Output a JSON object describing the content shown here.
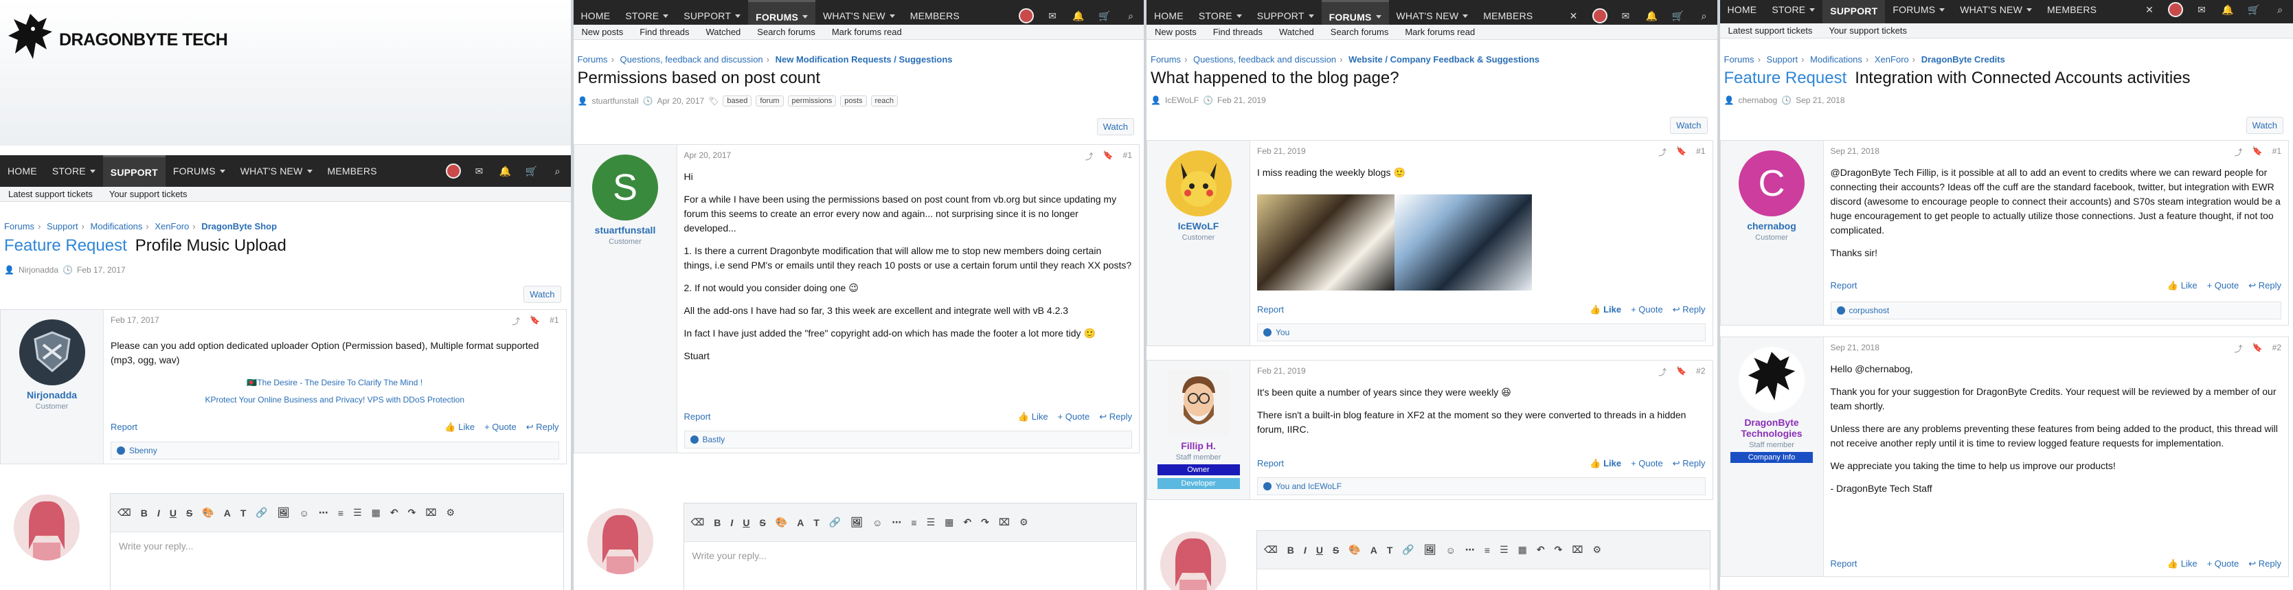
{
  "site": {
    "name": "DRAGONBYTE TECH"
  },
  "nav": {
    "home": "HOME",
    "store": "STORE",
    "support": "SUPPORT",
    "forums": "FORUMS",
    "whats_new": "WHAT'S NEW",
    "members": "MEMBERS"
  },
  "icons": [
    "mail-icon",
    "bell-icon",
    "cart-icon",
    "search-icon"
  ],
  "panel1": {
    "subnav": [
      "Latest support tickets",
      "Your support tickets"
    ],
    "crumbs": [
      "Forums",
      "Support",
      "Modifications",
      "XenForo",
      "DragonByte Shop"
    ],
    "prefix": "Feature Request",
    "title": "Profile Music Upload",
    "author": "Nirjonadda",
    "date": "Feb 17, 2017",
    "watch": "Watch",
    "post": {
      "user": "Nirjonadda",
      "usertitle": "Customer",
      "date": "Feb 17, 2017",
      "num": "#1",
      "text": "Please can you add option dedicated uploader Option (Permission based), Multiple format supported (mp3, ogg, wav)",
      "sig1": "The Desire - The Desire To Clarify The Mind !",
      "sig2": "Protect Your Online Business and Privacy! VPS with DDoS Protection",
      "report": "Report",
      "like": "Like",
      "quote": "+ Quote",
      "reply": "Reply",
      "reacted": "Sbenny"
    },
    "editor_placeholder": "Write your reply..."
  },
  "panel2": {
    "subnav": [
      "New posts",
      "Find threads",
      "Watched",
      "Search forums",
      "Mark forums read"
    ],
    "crumbs": [
      "Forums",
      "Questions, feedback and discussion",
      "New Modification Requests / Suggestions"
    ],
    "title": "Permissions based on post count",
    "author": "stuartfunstall",
    "date": "Apr 20, 2017",
    "tags": [
      "based",
      "forum",
      "permissions",
      "posts",
      "reach"
    ],
    "watch": "Watch",
    "post": {
      "user": "stuartfunstall",
      "usertitle": "Customer",
      "date": "Apr 20, 2017",
      "num": "#1",
      "p1": "Hi",
      "p2": "For a while I have been using the permissions based on post count from vb.org but since updating my forum this seems to create an error every now and again... not surprising since it is no longer developed...",
      "p3": "1. Is there a current Dragonbyte modification that will allow me to stop new members doing certain things, i.e send PM's or emails until they reach 10 posts or use a certain forum until they reach XX posts?",
      "p4": "2. If not would you consider doing one",
      "p5": "All the add-ons I have had so far, 3 this week are excellent and integrate well with vB 4.2.3",
      "p6": "In fact I have just added the \"free\" copyright add-on which has made the footer a lot more tidy",
      "p7": "Stuart",
      "report": "Report",
      "like": "Like",
      "quote": "+ Quote",
      "reply": "Reply",
      "reacted": "Bastly"
    },
    "editor_placeholder": "Write your reply..."
  },
  "panel3": {
    "subnav": [
      "New posts",
      "Find threads",
      "Watched",
      "Search forums",
      "Mark forums read"
    ],
    "crumbs": [
      "Forums",
      "Questions, feedback and discussion",
      "Website / Company Feedback & Suggestions"
    ],
    "title": "What happened to the blog page?",
    "author": "IcEWoLF",
    "date": "Feb 21, 2019",
    "watch": "Watch",
    "post1": {
      "user": "IcEWoLF",
      "usertitle": "Customer",
      "date": "Feb 21, 2019",
      "num": "#1",
      "text": "I miss reading the weekly blogs",
      "report": "Report",
      "like": "Like",
      "quote": "+ Quote",
      "reply": "Reply",
      "reacted": "You"
    },
    "post2": {
      "user": "Fillip H.",
      "usertitle": "Staff member",
      "banner1": "Owner",
      "banner2": "Developer",
      "date": "Feb 21, 2019",
      "num": "#2",
      "p1": "It's been quite a number of years since they were weekly",
      "p2": "There isn't a built-in blog feature in XF2 at the moment so they were converted to threads in a hidden forum, IIRC.",
      "report": "Report",
      "like": "Like",
      "quote": "+ Quote",
      "reply": "Reply",
      "reacted": "You and IcEWoLF"
    }
  },
  "panel4": {
    "subnav": [
      "Latest support tickets",
      "Your support tickets"
    ],
    "crumbs": [
      "Forums",
      "Support",
      "Modifications",
      "XenForo",
      "DragonByte Credits"
    ],
    "prefix": "Feature Request",
    "title": "Integration with Connected Accounts activities",
    "author": "chernabog",
    "date": "Sep 21, 2018",
    "watch": "Watch",
    "post1": {
      "user": "chernabog",
      "usertitle": "Customer",
      "date": "Sep 21, 2018",
      "num": "#1",
      "p1": "@DragonByte Tech Fillip, is it possible at all to add an event to credits where we can reward people for connecting their accounts? Ideas off the cuff are the standard facebook, twitter, but integration with EWR discord (awesome to encourage people to connect their accounts) and S70s steam integration would be a huge encouragement to get people to actually utilize those connections. Just a feature thought, if not too complicated.",
      "p2": "Thanks sir!",
      "report": "Report",
      "like": "Like",
      "quote": "+ Quote",
      "reply": "Reply",
      "reacted": "corpushost"
    },
    "post2": {
      "user": "DragonByte Technologies",
      "usertitle": "Staff member",
      "banner": "Company Info",
      "date": "Sep 21, 2018",
      "num": "#2",
      "p1": "Hello @chernabog,",
      "p2": "Thank you for your suggestion for DragonByte Credits. Your request will be reviewed by a member of our team shortly.",
      "p3": "Unless there are any problems preventing these features from being added to the product, this thread will not receive another reply until it is time to review logged feature requests for implementation.",
      "p4": "We appreciate you taking the time to help us improve our products!",
      "p5": "- DragonByte Tech Staff",
      "report": "Report",
      "like": "Like",
      "quote": "+ Quote",
      "reply": "Reply"
    }
  },
  "colors": {
    "accent": "#2b6fb6",
    "navbar": "#262626",
    "owner": "#1a1ab8",
    "developer": "#5bb8e0",
    "company": "#1a4fc4"
  }
}
